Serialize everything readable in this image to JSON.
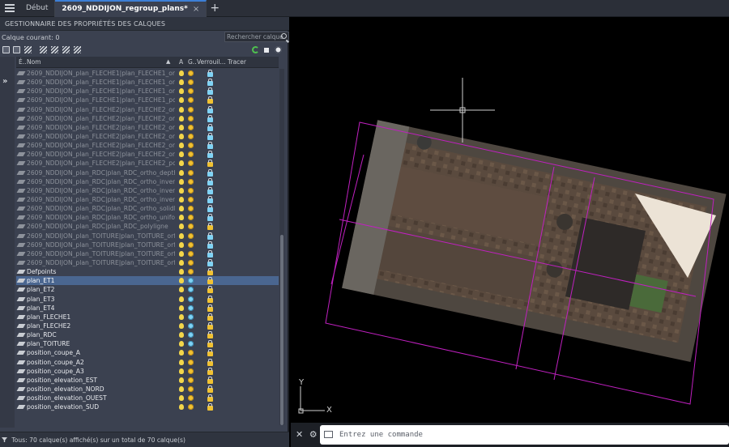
{
  "tabs": {
    "home_label": "Début",
    "doc_label": "2609_NDDIJON_regroup_plans*",
    "close_glyph": "×",
    "add_glyph": "+"
  },
  "palette": {
    "title": "GESTIONNAIRE DES PROPRIÉTÉS DES CALQUES",
    "current_layer": "Calque courant: 0",
    "search_placeholder": "Rechercher calque",
    "columns": {
      "status": "É..",
      "name": "Nom",
      "on": "A",
      "freeze": "G..",
      "lock": "Verrouil...",
      "plot": "Tracer"
    },
    "layers": [
      {
        "name": "2609_NDDIJON_plan_FLECHE1|plan_FLECHE1_ortho...",
        "dim": true,
        "frozen": false,
        "locked": true
      },
      {
        "name": "2609_NDDIJON_plan_FLECHE1|plan_FLECHE1_ortho...",
        "dim": true,
        "frozen": false,
        "locked": true
      },
      {
        "name": "2609_NDDIJON_plan_FLECHE1|plan_FLECHE1_ortho...",
        "dim": true,
        "frozen": false,
        "locked": true
      },
      {
        "name": "2609_NDDIJON_plan_FLECHE1|plan_FLECHE1_polyli...",
        "dim": true,
        "frozen": false,
        "locked": false
      },
      {
        "name": "2609_NDDIJON_plan_FLECHE2|plan_FLECHE2_ortho...",
        "dim": true,
        "frozen": false,
        "locked": true
      },
      {
        "name": "2609_NDDIJON_plan_FLECHE2|plan_FLECHE2_ortho...",
        "dim": true,
        "frozen": false,
        "locked": true
      },
      {
        "name": "2609_NDDIJON_plan_FLECHE2|plan_FLECHE2_ortho...",
        "dim": true,
        "frozen": false,
        "locked": true
      },
      {
        "name": "2609_NDDIJON_plan_FLECHE2|plan_FLECHE2_ortho...",
        "dim": true,
        "frozen": false,
        "locked": true
      },
      {
        "name": "2609_NDDIJON_plan_FLECHE2|plan_FLECHE2_ortho...",
        "dim": true,
        "frozen": false,
        "locked": true
      },
      {
        "name": "2609_NDDIJON_plan_FLECHE2|plan_FLECHE2_ortho...",
        "dim": true,
        "frozen": false,
        "locked": true
      },
      {
        "name": "2609_NDDIJON_plan_FLECHE2|plan_FLECHE2_polyli...",
        "dim": true,
        "frozen": false,
        "locked": false
      },
      {
        "name": "2609_NDDIJON_plan_RDC|plan_RDC_ortho_depth",
        "dim": true,
        "frozen": false,
        "locked": true
      },
      {
        "name": "2609_NDDIJON_plan_RDC|plan_RDC_ortho_inverse_...",
        "dim": true,
        "frozen": false,
        "locked": true
      },
      {
        "name": "2609_NDDIJON_plan_RDC|plan_RDC_ortho_inverse_...",
        "dim": true,
        "frozen": false,
        "locked": true
      },
      {
        "name": "2609_NDDIJON_plan_RDC|plan_RDC_ortho_inverse_...",
        "dim": true,
        "frozen": false,
        "locked": true
      },
      {
        "name": "2609_NDDIJON_plan_RDC|plan_RDC_ortho_solidFill",
        "dim": true,
        "frozen": false,
        "locked": true
      },
      {
        "name": "2609_NDDIJON_plan_RDC|plan_RDC_ortho_uniform",
        "dim": true,
        "frozen": false,
        "locked": true
      },
      {
        "name": "2609_NDDIJON_plan_RDC|plan_RDC_polyligne",
        "dim": true,
        "frozen": false,
        "locked": false
      },
      {
        "name": "2609_NDDIJON_plan_TOITURE|plan_TOITURE_ortho...",
        "dim": true,
        "frozen": false,
        "locked": true
      },
      {
        "name": "2609_NDDIJON_plan_TOITURE|plan_TOITURE_ortho...",
        "dim": true,
        "frozen": false,
        "locked": true
      },
      {
        "name": "2609_NDDIJON_plan_TOITURE|plan_TOITURE_ortho...",
        "dim": true,
        "frozen": false,
        "locked": true
      },
      {
        "name": "2609_NDDIJON_plan_TOITURE|plan_TOITURE_ortho...",
        "dim": true,
        "frozen": false,
        "locked": true
      },
      {
        "name": "Defpoints",
        "dim": false,
        "frozen": false,
        "locked": false
      },
      {
        "name": "plan_ET1",
        "dim": false,
        "frozen": true,
        "locked": false,
        "selected": true
      },
      {
        "name": "plan_ET2",
        "dim": false,
        "frozen": true,
        "locked": false
      },
      {
        "name": "plan_ET3",
        "dim": false,
        "frozen": true,
        "locked": false
      },
      {
        "name": "plan_ET4",
        "dim": false,
        "frozen": true,
        "locked": false
      },
      {
        "name": "plan_FLECHE1",
        "dim": false,
        "frozen": true,
        "locked": false
      },
      {
        "name": "plan_FLECHE2",
        "dim": false,
        "frozen": true,
        "locked": false
      },
      {
        "name": "plan_RDC",
        "dim": false,
        "frozen": true,
        "locked": false
      },
      {
        "name": "plan_TOITURE",
        "dim": false,
        "frozen": true,
        "locked": false
      },
      {
        "name": "position_coupe_A",
        "dim": false,
        "frozen": false,
        "locked": false
      },
      {
        "name": "position_coupe_A2",
        "dim": false,
        "frozen": false,
        "locked": false
      },
      {
        "name": "position_coupe_A3",
        "dim": false,
        "frozen": false,
        "locked": false
      },
      {
        "name": "position_elevation_EST",
        "dim": false,
        "frozen": false,
        "locked": false
      },
      {
        "name": "position_elevation_NORD",
        "dim": false,
        "frozen": false,
        "locked": false
      },
      {
        "name": "position_elevation_OUEST",
        "dim": false,
        "frozen": false,
        "locked": false
      },
      {
        "name": "position_elevation_SUD",
        "dim": false,
        "frozen": false,
        "locked": false
      }
    ],
    "status_text": "Tous: 70 calque(s) affiché(s) sur un total de 70 calque(s)"
  },
  "canvas": {
    "ucs_x": "X",
    "ucs_y": "Y"
  },
  "command": {
    "placeholder": "Entrez une commande"
  },
  "colors": {
    "magenta": "#c020c0",
    "panel": "#3b4150",
    "selection": "#4a6690"
  }
}
